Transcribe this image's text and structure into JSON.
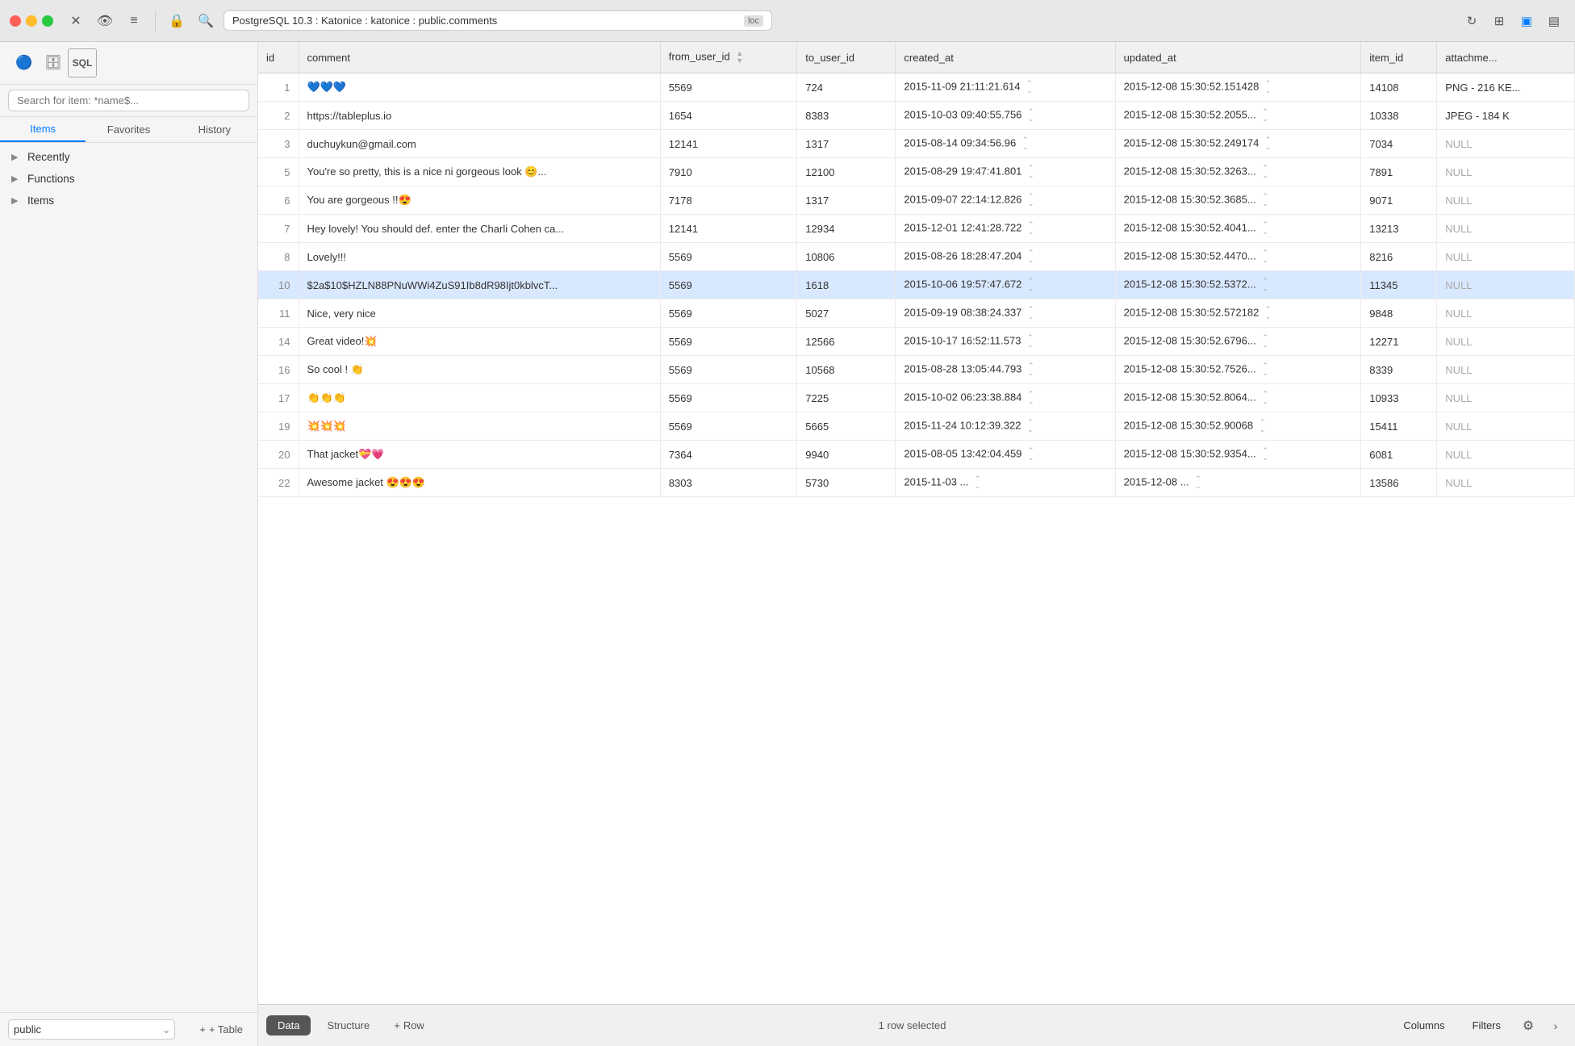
{
  "titlebar": {
    "address": "PostgreSQL 10.3 : Katonice : katonice : public.comments",
    "badge": "loc"
  },
  "sidebar": {
    "search_placeholder": "Search for item: *name$...",
    "tabs": [
      "Items",
      "Favorites",
      "History"
    ],
    "active_tab": "Items",
    "tree": [
      {
        "label": "Recently",
        "chevron": "▶"
      },
      {
        "label": "Functions",
        "chevron": "▶"
      },
      {
        "label": "Items",
        "chevron": "▶"
      }
    ],
    "footer": {
      "schema": "public",
      "add_table": "+ Table"
    }
  },
  "table": {
    "columns": [
      "id",
      "comment",
      "from_user_id",
      "to_user_id",
      "created_at",
      "updated_at",
      "item_id",
      "attachme..."
    ],
    "rows": [
      {
        "id": "1",
        "comment": "💙💙💙",
        "from_user_id": "5569",
        "to_user_id": "724",
        "created_at": "2015-11-09 21:11:21.614",
        "updated_at": "2015-12-08 15:30:52.151428",
        "item_id": "14108",
        "attachment": "PNG - 216 KE..."
      },
      {
        "id": "2",
        "comment": "https://tableplus.io",
        "from_user_id": "1654",
        "to_user_id": "8383",
        "created_at": "2015-10-03 09:40:55.756",
        "updated_at": "2015-12-08 15:30:52.2055...",
        "item_id": "10338",
        "attachment": "JPEG - 184 K"
      },
      {
        "id": "3",
        "comment": "duchuykun@gmail.com",
        "from_user_id": "12141",
        "to_user_id": "1317",
        "created_at": "2015-08-14 09:34:56.96",
        "updated_at": "2015-12-08 15:30:52.249174",
        "item_id": "7034",
        "attachment": "NULL"
      },
      {
        "id": "5",
        "comment": "You're so pretty, this is a nice ni gorgeous look 😊...",
        "from_user_id": "7910",
        "to_user_id": "12100",
        "created_at": "2015-08-29 19:47:41.801",
        "updated_at": "2015-12-08 15:30:52.3263...",
        "item_id": "7891",
        "attachment": "NULL"
      },
      {
        "id": "6",
        "comment": "You are gorgeous !!😍",
        "from_user_id": "7178",
        "to_user_id": "1317",
        "created_at": "2015-09-07 22:14:12.826",
        "updated_at": "2015-12-08 15:30:52.3685...",
        "item_id": "9071",
        "attachment": "NULL"
      },
      {
        "id": "7",
        "comment": "Hey lovely! You should def. enter the Charli Cohen ca...",
        "from_user_id": "12141",
        "to_user_id": "12934",
        "created_at": "2015-12-01 12:41:28.722",
        "updated_at": "2015-12-08 15:30:52.4041...",
        "item_id": "13213",
        "attachment": "NULL"
      },
      {
        "id": "8",
        "comment": "Lovely!!!",
        "from_user_id": "5569",
        "to_user_id": "10806",
        "created_at": "2015-08-26 18:28:47.204",
        "updated_at": "2015-12-08 15:30:52.4470...",
        "item_id": "8216",
        "attachment": "NULL"
      },
      {
        "id": "10",
        "comment": "$2a$10$HZLN88PNuWWi4ZuS91Ib8dR98Ijt0kblvcT...",
        "from_user_id": "5569",
        "to_user_id": "1618",
        "created_at": "2015-10-06 19:57:47.672",
        "updated_at": "2015-12-08 15:30:52.5372...",
        "item_id": "11345",
        "attachment": "NULL",
        "selected": true
      },
      {
        "id": "11",
        "comment": "Nice, very nice",
        "from_user_id": "5569",
        "to_user_id": "5027",
        "created_at": "2015-09-19 08:38:24.337",
        "updated_at": "2015-12-08 15:30:52.572182",
        "item_id": "9848",
        "attachment": "NULL"
      },
      {
        "id": "14",
        "comment": "Great video!💥",
        "from_user_id": "5569",
        "to_user_id": "12566",
        "created_at": "2015-10-17 16:52:11.573",
        "updated_at": "2015-12-08 15:30:52.6796...",
        "item_id": "12271",
        "attachment": "NULL"
      },
      {
        "id": "16",
        "comment": "So cool ! 👏",
        "from_user_id": "5569",
        "to_user_id": "10568",
        "created_at": "2015-08-28 13:05:44.793",
        "updated_at": "2015-12-08 15:30:52.7526...",
        "item_id": "8339",
        "attachment": "NULL"
      },
      {
        "id": "17",
        "comment": "👏👏👏",
        "from_user_id": "5569",
        "to_user_id": "7225",
        "created_at": "2015-10-02 06:23:38.884",
        "updated_at": "2015-12-08 15:30:52.8064...",
        "item_id": "10933",
        "attachment": "NULL"
      },
      {
        "id": "19",
        "comment": "💥💥💥",
        "from_user_id": "5569",
        "to_user_id": "5665",
        "created_at": "2015-11-24 10:12:39.322",
        "updated_at": "2015-12-08 15:30:52.90068",
        "item_id": "15411",
        "attachment": "NULL"
      },
      {
        "id": "20",
        "comment": "That jacket💝💗",
        "from_user_id": "7364",
        "to_user_id": "9940",
        "created_at": "2015-08-05 13:42:04.459",
        "updated_at": "2015-12-08 15:30:52.9354...",
        "item_id": "6081",
        "attachment": "NULL"
      },
      {
        "id": "22",
        "comment": "Awesome jacket 😍😍😍",
        "from_user_id": "8303",
        "to_user_id": "5730",
        "created_at": "2015-11-03 ...",
        "updated_at": "2015-12-08 ...",
        "item_id": "13586",
        "attachment": "NULL"
      }
    ]
  },
  "bottombar": {
    "tabs": [
      "Data",
      "Structure"
    ],
    "active_tab": "Data",
    "add_row": "+ Row",
    "status": "1 row selected",
    "columns_btn": "Columns",
    "filters_btn": "Filters"
  }
}
